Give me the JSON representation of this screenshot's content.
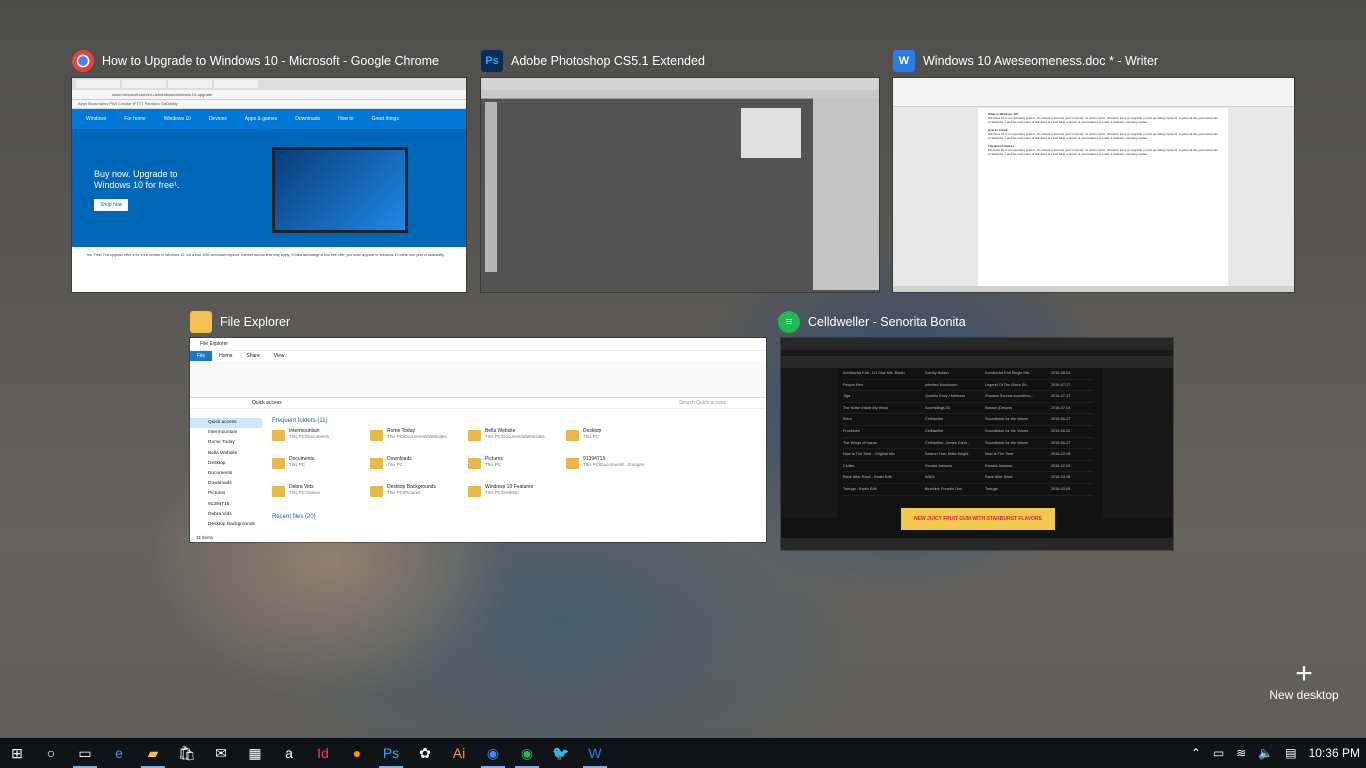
{
  "windows": [
    {
      "title": "How to Upgrade to Windows 10 - Microsoft - Google Chrome",
      "icon": "chrome-icon"
    },
    {
      "title": "Adobe Photoshop CS5.1 Extended",
      "icon": "photoshop-icon"
    },
    {
      "title": "Windows 10 Aweseomeness.doc * - Writer",
      "icon": "writer-icon"
    },
    {
      "title": "File Explorer",
      "icon": "file-explorer-icon"
    },
    {
      "title": "Celldweller - Senorita Bonita",
      "icon": "spotify-icon"
    }
  ],
  "chrome_thumb": {
    "address": "www.microsoft.com/en-us/windows/windows-10-upgrade",
    "bookmarks": "Apps  Bookmarks  PWI  Crackle  IFTTT  Pandora  GoDaddy",
    "nav": [
      "Windows",
      "For home",
      "Windows 10",
      "Devices",
      "Apps & games",
      "Downloads",
      "How to",
      "Great things"
    ],
    "hero_text": "Buy now. Upgrade to Windows 10 for free¹.",
    "hero_button": "Shop now",
    "body_text": "Yes. Free! This upgrade offer is for a full version of Windows 10, not a trial. 3GB download required; internet access fees may apply. To take advantage of this free offer, you must upgrade to Windows 10 within one year of availability."
  },
  "writer_thumb": {
    "heading1": "What is Windows 10?",
    "heading2": "How to Install",
    "heading3": "The Best Features",
    "body": "Windows 10 is an operating system. It's software that lets your computer do what it does. Windows 10 is an upgrade to past operating systems. It takes all the good elements of Windows 7 and the best parts of Windows 8.1 and adds a bunch of new features to make a fantastic operating system."
  },
  "explorer_thumb": {
    "title": "File Explorer",
    "menu": [
      "File",
      "Home",
      "Share",
      "View"
    ],
    "address": "Quick access",
    "search_placeholder": "Search Quick access",
    "nav": [
      "Quick access",
      "Intermountain",
      "Rome Today",
      "Bella Website",
      "Desktop",
      "Documents",
      "Downloads",
      "Pictures",
      "91394715",
      "Debra Vids",
      "Desktop Backgrounds"
    ],
    "frequent_header": "Frequent folders (11)",
    "folders": [
      {
        "name": "Intermountain",
        "path": "This PC\\Documents"
      },
      {
        "name": "Rome Today",
        "path": "This PC\\Documents\\Websites"
      },
      {
        "name": "Bella Website",
        "path": "This PC\\Documents\\Websites"
      },
      {
        "name": "Desktop",
        "path": "This PC"
      },
      {
        "name": "Documents",
        "path": "This PC"
      },
      {
        "name": "Downloads",
        "path": "This PC"
      },
      {
        "name": "Pictures",
        "path": "This PC"
      },
      {
        "name": "91394715",
        "path": "This PC\\Documents\\...\\Images"
      },
      {
        "name": "Debra Vids",
        "path": "This PC\\Videos"
      },
      {
        "name": "Desktop Backgrounds",
        "path": "This PC\\Pictures"
      },
      {
        "name": "Windows 10 Features",
        "path": "This PC\\Desktop"
      }
    ],
    "recent_header": "Recent files (20)",
    "status": "31 items"
  },
  "spotify_thumb": {
    "rows": [
      {
        "song": "Kombucha Knit - DJ Glaz Mix, Radio",
        "artist": "Zomby Nation",
        "album": "Kombucha Knit Single Mix",
        "date": "2016-08-01"
      },
      {
        "song": "Pequin Mex",
        "artist": "Infected Mushroom",
        "album": "Legend Of The Black Sh...",
        "date": "2016-07-27"
      },
      {
        "song": "Tiga",
        "artist": "Quantic Envy / Methodx",
        "album": "Shadow Sounds soundtrac...",
        "date": "2016-07-27"
      },
      {
        "song": "The Noise Inside My Head",
        "artist": "Accendings 33",
        "album": "Illusion (Deluxe)",
        "date": "2016-07-04"
      },
      {
        "song": "Elero",
        "artist": "Celldweller",
        "album": "Soundtrack for the Voices",
        "date": "2016-06-27"
      },
      {
        "song": "Frontlines",
        "artist": "Celldweller",
        "album": "Soundtrack for the Voices",
        "date": "2016-06-22"
      },
      {
        "song": "The Wings of Icarus",
        "artist": "Celldweller, James Contr...",
        "album": "Soundtrack for the Voices",
        "date": "2016-06-27"
      },
      {
        "song": "Now Is The Time - Original Mix",
        "artist": "Sasson Tala, Miike Knight",
        "album": "Now Is The Time",
        "date": "2016-02-08"
      },
      {
        "song": "Clutter",
        "artist": "Ronald Jenkees",
        "album": "Ronald Jenkees",
        "date": "2016-02-03"
      },
      {
        "song": "Rave After Rave - Radio Edit",
        "artist": "W&W",
        "album": "Rave After Rave",
        "date": "2016-03-06"
      },
      {
        "song": "Tortuga - Radio Edit",
        "artist": "Bluebird; Fremtid Ono",
        "album": "Tortuga",
        "date": "2016-03-05"
      }
    ],
    "ad": "NEW JUICY FRUIT GUM WITH STARBURST FLAVORS"
  },
  "new_desktop": "New desktop",
  "taskbar": {
    "icons": [
      "windows-start-icon",
      "cortana-icon",
      "task-view-icon",
      "edge-icon",
      "file-explorer-icon",
      "store-icon",
      "mail-icon",
      "calculator-icon",
      "amazon-icon",
      "indesign-icon",
      "firefox-icon",
      "photoshop-icon",
      "picasa-icon",
      "illustrator-icon",
      "chrome-icon",
      "spotify-icon",
      "twitter-icon",
      "writer-icon"
    ],
    "clock": "10:36 PM"
  }
}
